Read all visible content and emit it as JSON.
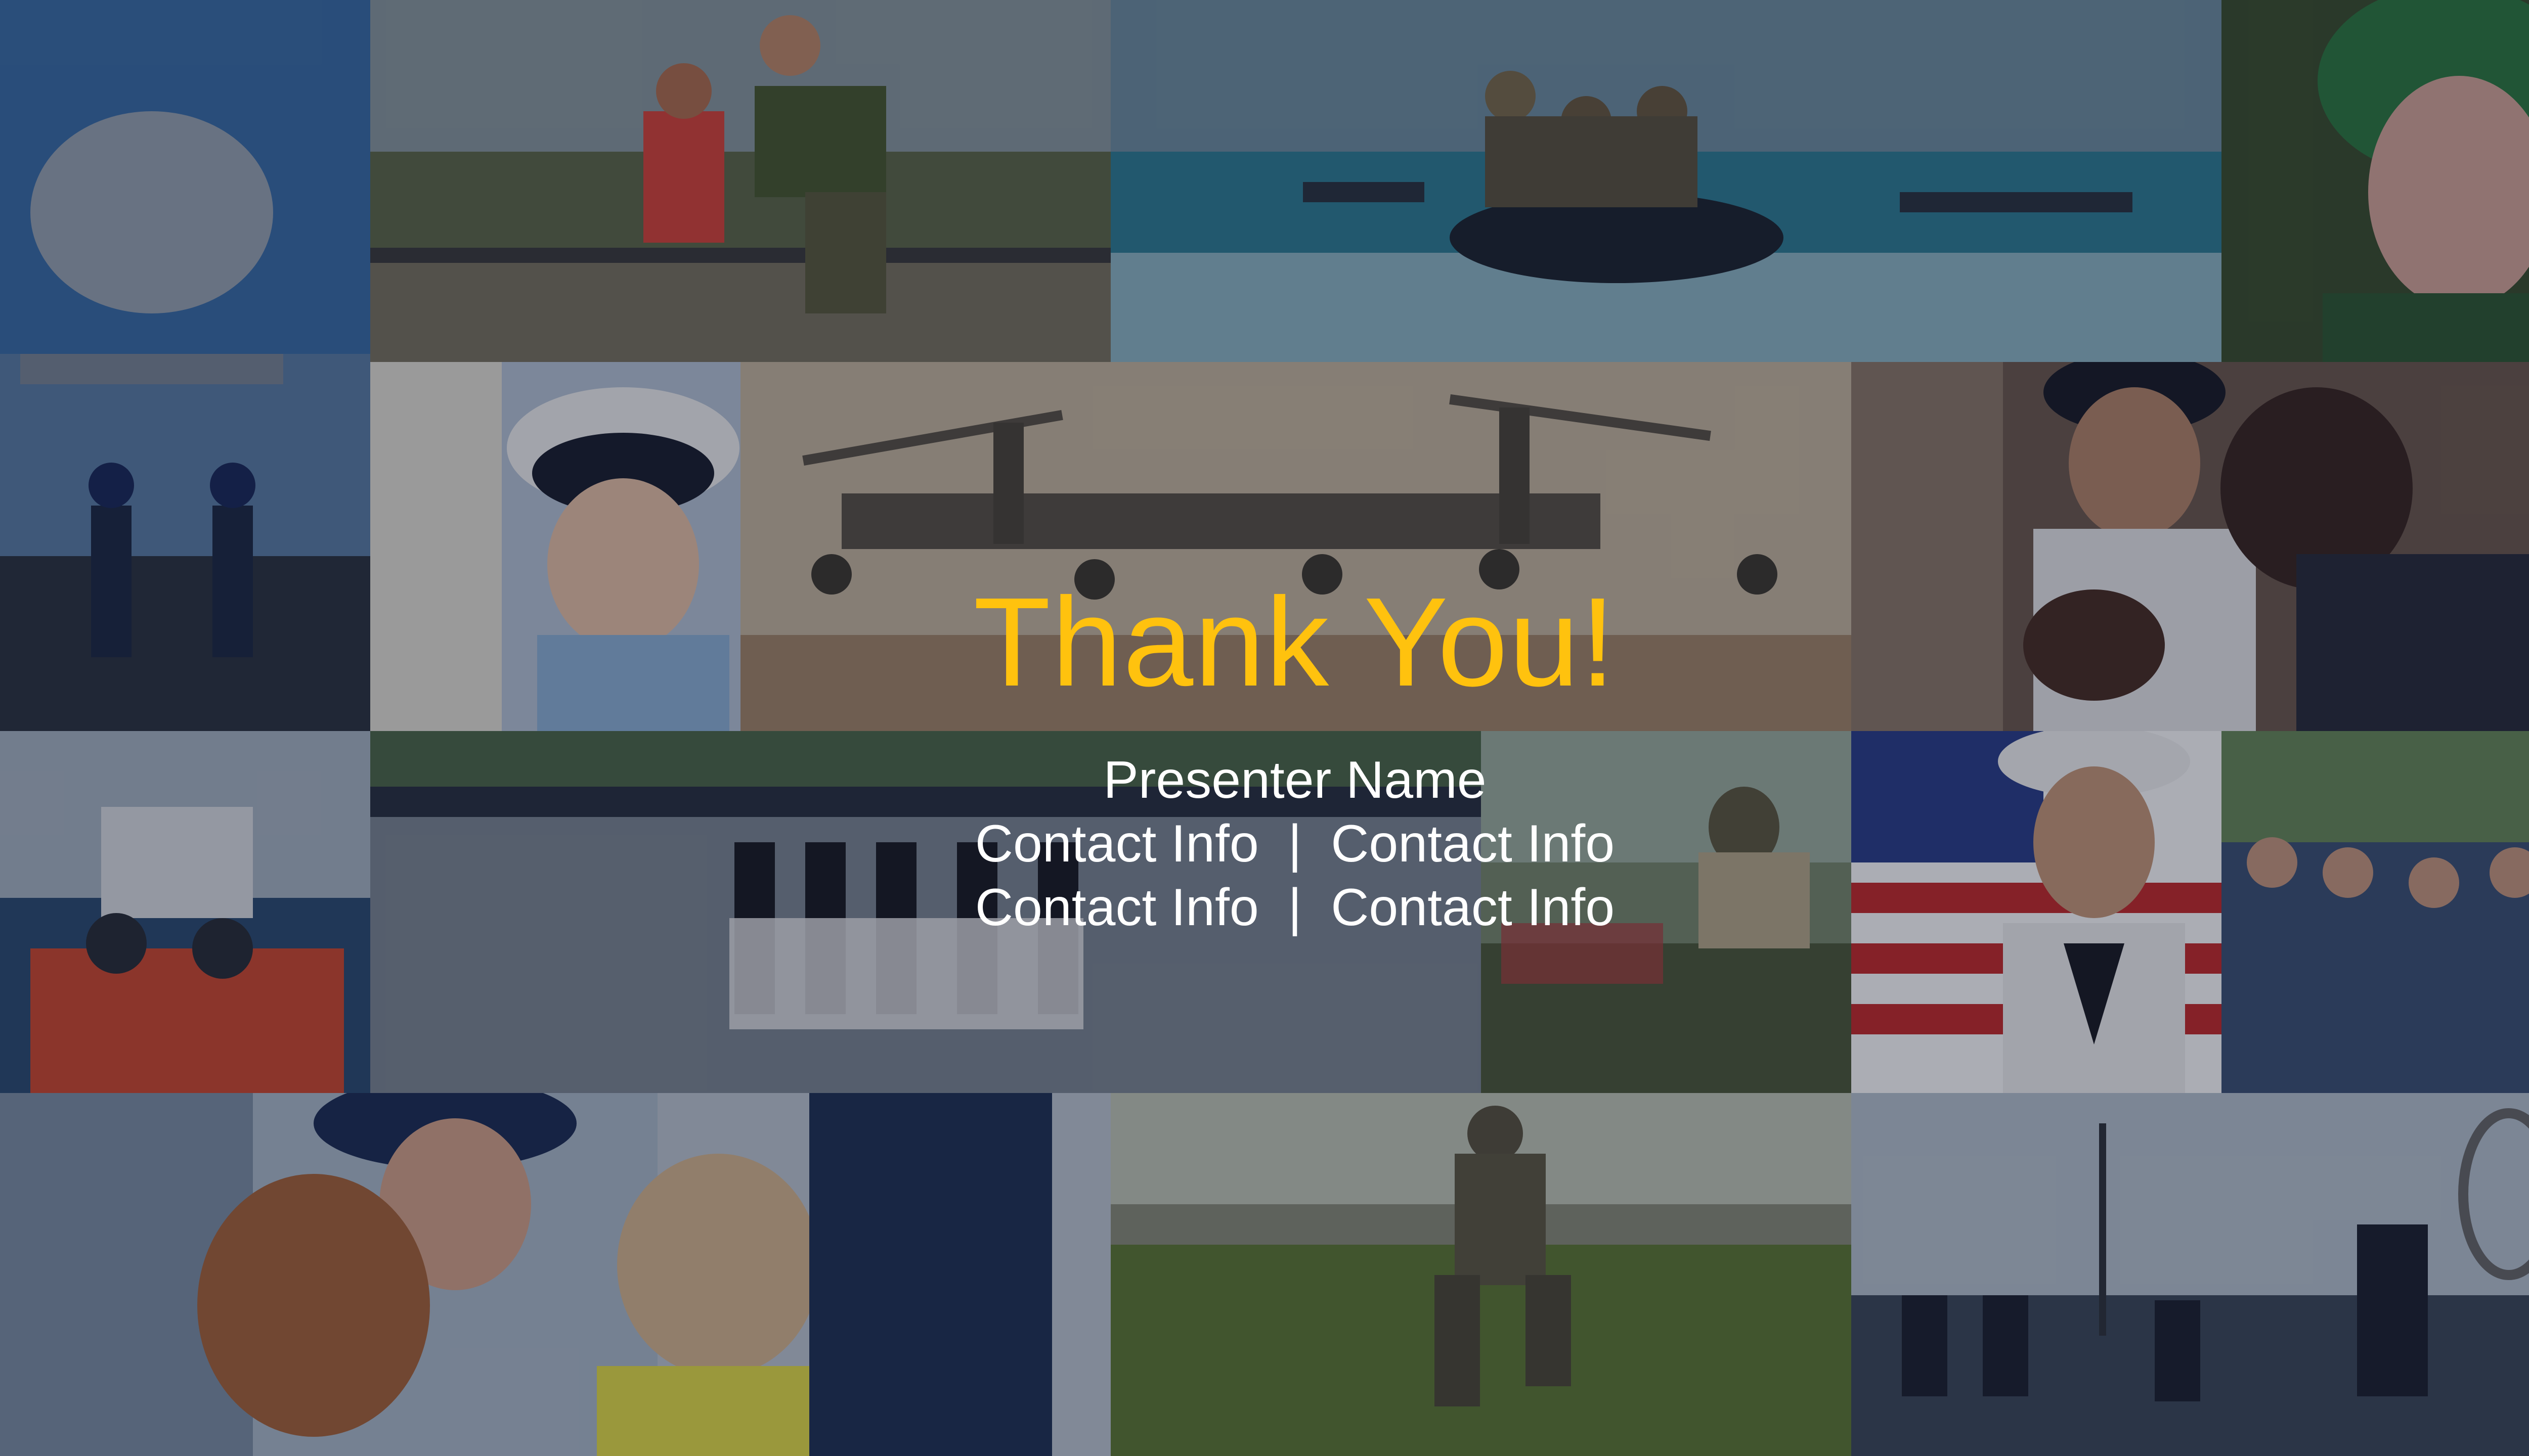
{
  "slide": {
    "title": "Thank You!",
    "presenter": "Presenter Name",
    "contact_rows": [
      "Contact Info  |  Contact Info",
      "Contact Info  |  Contact Info"
    ]
  },
  "colors": {
    "title": "#ffc20e",
    "text": "#ffffff",
    "background": "#0b0f18"
  },
  "photos": [
    {
      "subject": "navy-helicopter-landing"
    },
    {
      "subject": "marine-helping-boy-over-bar"
    },
    {
      "subject": "troops-in-inflatable-boat"
    },
    {
      "subject": "pilot-in-green-helmet"
    },
    {
      "subject": "flight-deck-crew"
    },
    {
      "subject": "boy-wearing-sailor-cap"
    },
    {
      "subject": "troops-near-tiltrotor-aircraft"
    },
    {
      "subject": "officer-family-embrace"
    },
    {
      "subject": "coast-guard-boat"
    },
    {
      "subject": "marine-honor-guard-parade"
    },
    {
      "subject": "soldier-repairing-vehicle"
    },
    {
      "subject": "sailor-with-american-flag"
    },
    {
      "subject": "recruits-in-formation"
    },
    {
      "subject": "coast-guard-father-with-children"
    },
    {
      "subject": "soldier-in-field"
    },
    {
      "subject": "sailors-on-ship-deck"
    }
  ]
}
